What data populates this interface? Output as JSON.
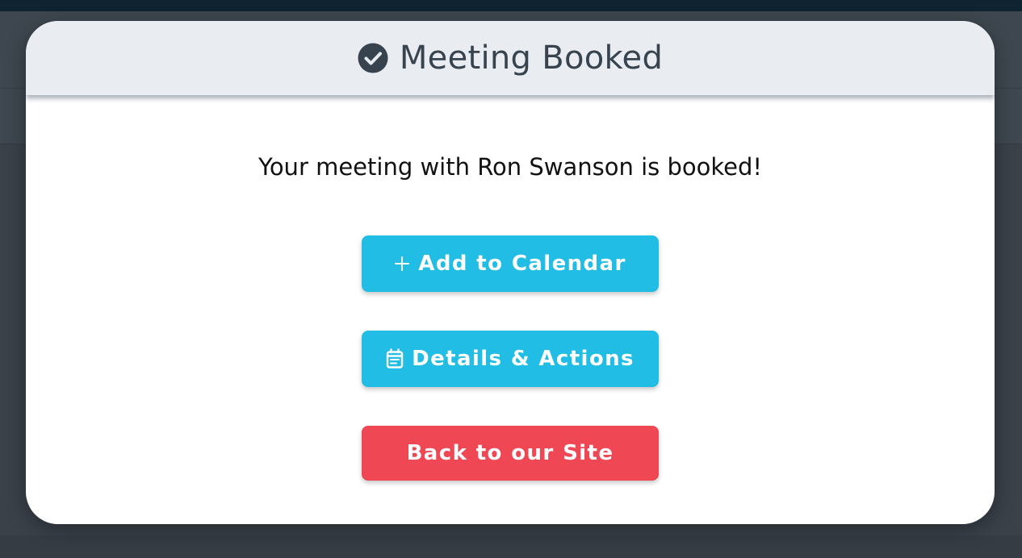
{
  "modal": {
    "title": "Meeting Booked",
    "title_icon": "check-circle-icon",
    "message": "Your meeting with Ron Swanson is booked!"
  },
  "buttons": {
    "add_to_calendar": {
      "label": "Add to Calendar",
      "icon": "plus-icon"
    },
    "details_actions": {
      "label": "Details & Actions",
      "icon": "calendar-notes-icon"
    },
    "back_to_site": {
      "label": "Back to our Site"
    }
  },
  "colors": {
    "primary_button": "#22bde4",
    "danger_button": "#ef4754",
    "header_bg": "#e9edf1",
    "title_text": "#37434f"
  }
}
